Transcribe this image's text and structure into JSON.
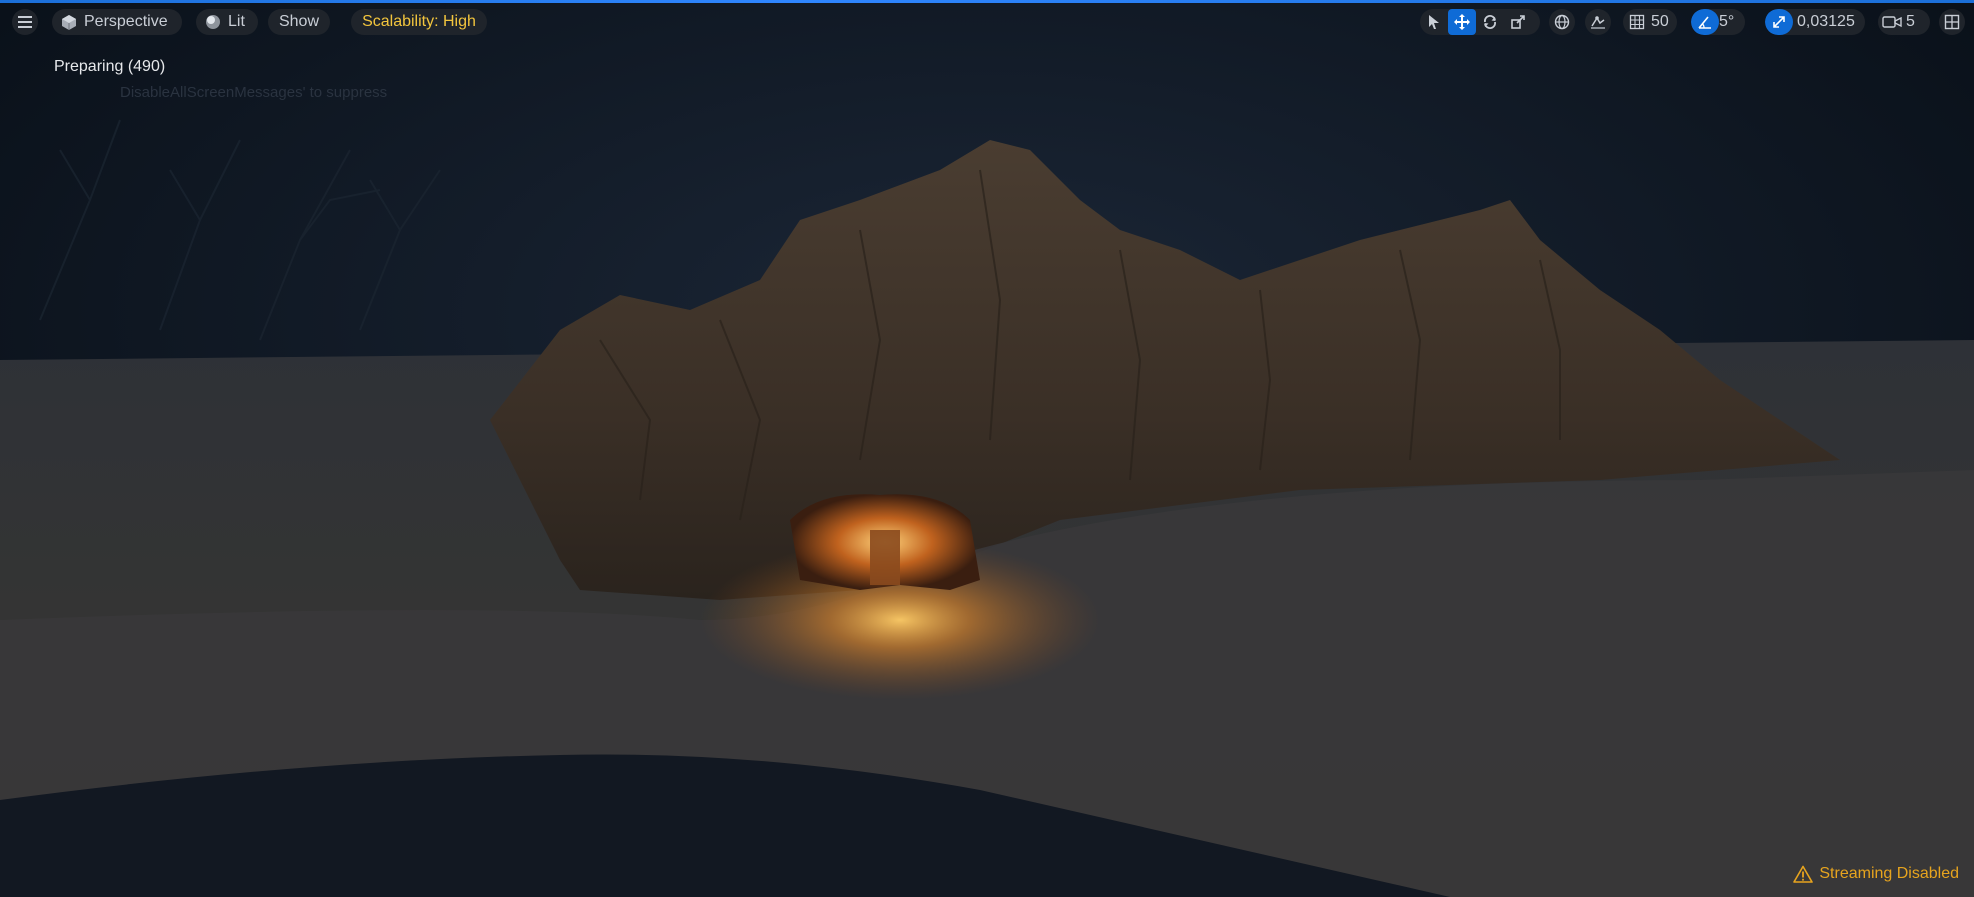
{
  "toolbar": {
    "menu_icon": "hamburger-menu-icon",
    "perspective_label": "Perspective",
    "lit_label": "Lit",
    "show_label": "Show",
    "scalability_label": "Scalability: High",
    "grid_snap_value": "50",
    "rotation_snap_value": "5°",
    "scale_snap_value": "0,03125",
    "camera_speed_value": "5"
  },
  "overlay": {
    "preparing_text": "Preparing  (490)",
    "hint_text": "DisableAllScreenMessages' to suppress"
  },
  "status": {
    "streaming_label": "Streaming Disabled",
    "warning_color": "#e7a41e"
  },
  "colors": {
    "accent": "#0f6bd6",
    "scalability_text": "#f2c53d",
    "toolbar_bg": "#1f242b"
  }
}
